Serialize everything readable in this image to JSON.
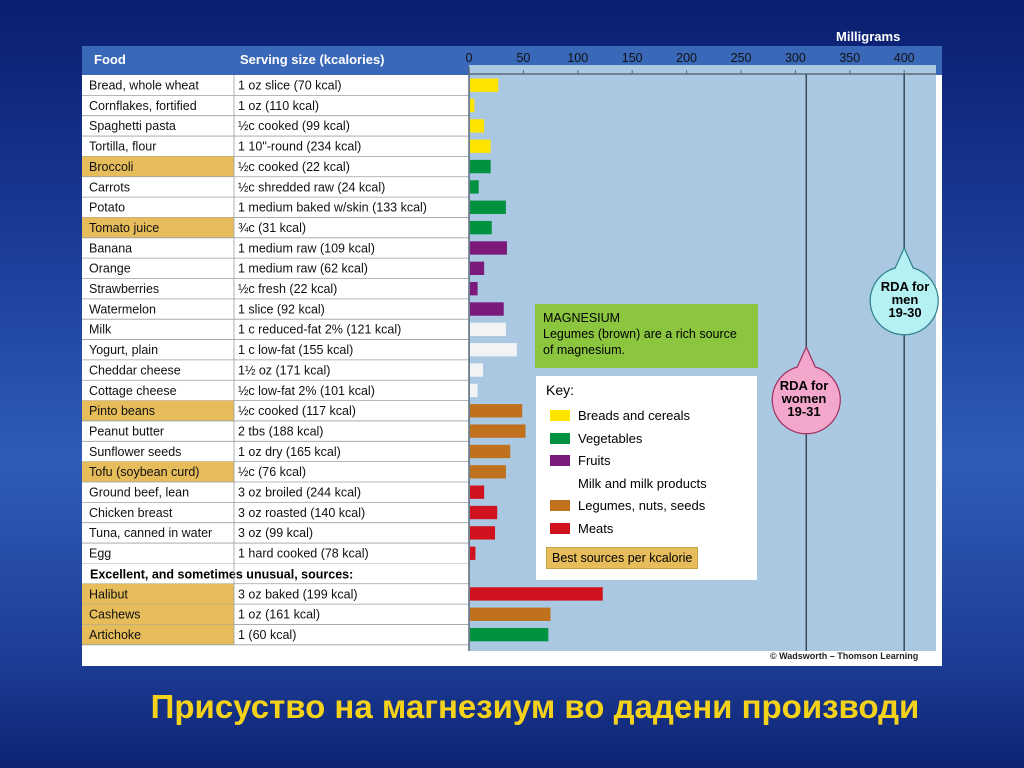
{
  "unit_label": "Milligrams",
  "col_food": "Food",
  "col_serving": "Serving size (kcalories)",
  "title": "Присуство на магнезиум во дадени производи",
  "credit": "© Wadsworth – Thomson Learning",
  "magnesium_box": {
    "line1": "MAGNESIUM",
    "line2": "Legumes (brown) are a rich source of magnesium."
  },
  "key": {
    "title": "Key:",
    "items": [
      {
        "label": "Breads and cereals",
        "color": "#ffe400"
      },
      {
        "label": "Vegetables",
        "color": "#00923f"
      },
      {
        "label": "Fruits",
        "color": "#7b1a7a"
      },
      {
        "label": "Milk and milk products",
        "color": "#ffffff"
      },
      {
        "label": "Legumes, nuts, seeds",
        "color": "#c0711e"
      },
      {
        "label": "Meats",
        "color": "#d0111e"
      }
    ],
    "best": "Best sources per kcalorie"
  },
  "rda_men": {
    "line1": "RDA for",
    "line2": "men",
    "line3": "19-30",
    "value": 400
  },
  "rda_women": {
    "line1": "RDA for",
    "line2": "women",
    "line3": "19-31",
    "value": 310
  },
  "chart_data": {
    "type": "bar",
    "orientation": "horizontal",
    "xlim": [
      0,
      430
    ],
    "x_ticks": [
      0,
      50,
      100,
      150,
      200,
      250,
      300,
      350,
      400
    ],
    "group_colors": {
      "bread": "#ffe400",
      "veg": "#00923f",
      "fruit": "#7b1a7a",
      "milk": "#f2f3f5",
      "legume": "#c0711e",
      "meat": "#d0111e"
    },
    "highlight_color": "#e6bd5a",
    "rows": [
      {
        "food": "Bread, whole wheat",
        "serving": "1 oz slice (70 kcal)",
        "value": 26,
        "group": "bread",
        "best": false
      },
      {
        "food": "Cornflakes, fortified",
        "serving": "1 oz (110 kcal)",
        "value": 4,
        "group": "bread",
        "best": false
      },
      {
        "food": "Spaghetti pasta",
        "serving": "½c cooked (99 kcal)",
        "value": 13,
        "group": "bread",
        "best": false
      },
      {
        "food": "Tortilla, flour",
        "serving": "1 10\"-round (234 kcal)",
        "value": 19,
        "group": "bread",
        "best": false
      },
      {
        "food": "Broccoli",
        "serving": "½c cooked (22 kcal)",
        "value": 19,
        "group": "veg",
        "best": true
      },
      {
        "food": "Carrots",
        "serving": "½c shredded raw (24 kcal)",
        "value": 8,
        "group": "veg",
        "best": false
      },
      {
        "food": "Potato",
        "serving": "1 medium baked w/skin (133 kcal)",
        "value": 33,
        "group": "veg",
        "best": false
      },
      {
        "food": "Tomato juice",
        "serving": "¾c (31 kcal)",
        "value": 20,
        "group": "veg",
        "best": true
      },
      {
        "food": "Banana",
        "serving": "1 medium raw (109 kcal)",
        "value": 34,
        "group": "fruit",
        "best": false
      },
      {
        "food": "Orange",
        "serving": "1 medium raw (62 kcal)",
        "value": 13,
        "group": "fruit",
        "best": false
      },
      {
        "food": "Strawberries",
        "serving": "½c fresh (22 kcal)",
        "value": 7,
        "group": "fruit",
        "best": false
      },
      {
        "food": "Watermelon",
        "serving": "1 slice (92 kcal)",
        "value": 31,
        "group": "fruit",
        "best": false
      },
      {
        "food": "Milk",
        "serving": "1 c reduced-fat 2% (121 kcal)",
        "value": 33,
        "group": "milk",
        "best": false
      },
      {
        "food": "Yogurt, plain",
        "serving": "1 c low-fat (155 kcal)",
        "value": 43,
        "group": "milk",
        "best": false
      },
      {
        "food": "Cheddar cheese",
        "serving": "1½ oz (171 kcal)",
        "value": 12,
        "group": "milk",
        "best": false
      },
      {
        "food": "Cottage cheese",
        "serving": "½c low-fat 2% (101 kcal)",
        "value": 7,
        "group": "milk",
        "best": false
      },
      {
        "food": "Pinto beans",
        "serving": "½c cooked (117 kcal)",
        "value": 48,
        "group": "legume",
        "best": true
      },
      {
        "food": "Peanut butter",
        "serving": "2 tbs (188 kcal)",
        "value": 51,
        "group": "legume",
        "best": false
      },
      {
        "food": "Sunflower seeds",
        "serving": "1 oz dry (165 kcal)",
        "value": 37,
        "group": "legume",
        "best": false
      },
      {
        "food": "Tofu (soybean curd)",
        "serving": "½c (76 kcal)",
        "value": 33,
        "group": "legume",
        "best": true
      },
      {
        "food": "Ground beef, lean",
        "serving": "3 oz broiled (244 kcal)",
        "value": 13,
        "group": "meat",
        "best": false
      },
      {
        "food": "Chicken breast",
        "serving": "3 oz roasted (140 kcal)",
        "value": 25,
        "group": "meat",
        "best": false
      },
      {
        "food": "Tuna, canned in water",
        "serving": "3 oz (99 kcal)",
        "value": 23,
        "group": "meat",
        "best": false
      },
      {
        "food": "Egg",
        "serving": "1 hard cooked (78 kcal)",
        "value": 5,
        "group": "meat",
        "best": false
      },
      {
        "section": "Excellent, and sometimes unusual, sources:"
      },
      {
        "food": "Halibut",
        "serving": "3 oz baked (199 kcal)",
        "value": 122,
        "group": "meat",
        "best": true
      },
      {
        "food": "Cashews",
        "serving": "1 oz (161 kcal)",
        "value": 74,
        "group": "legume",
        "best": true
      },
      {
        "food": "Artichoke",
        "serving": "1 (60 kcal)",
        "value": 72,
        "group": "veg",
        "best": true
      }
    ]
  }
}
